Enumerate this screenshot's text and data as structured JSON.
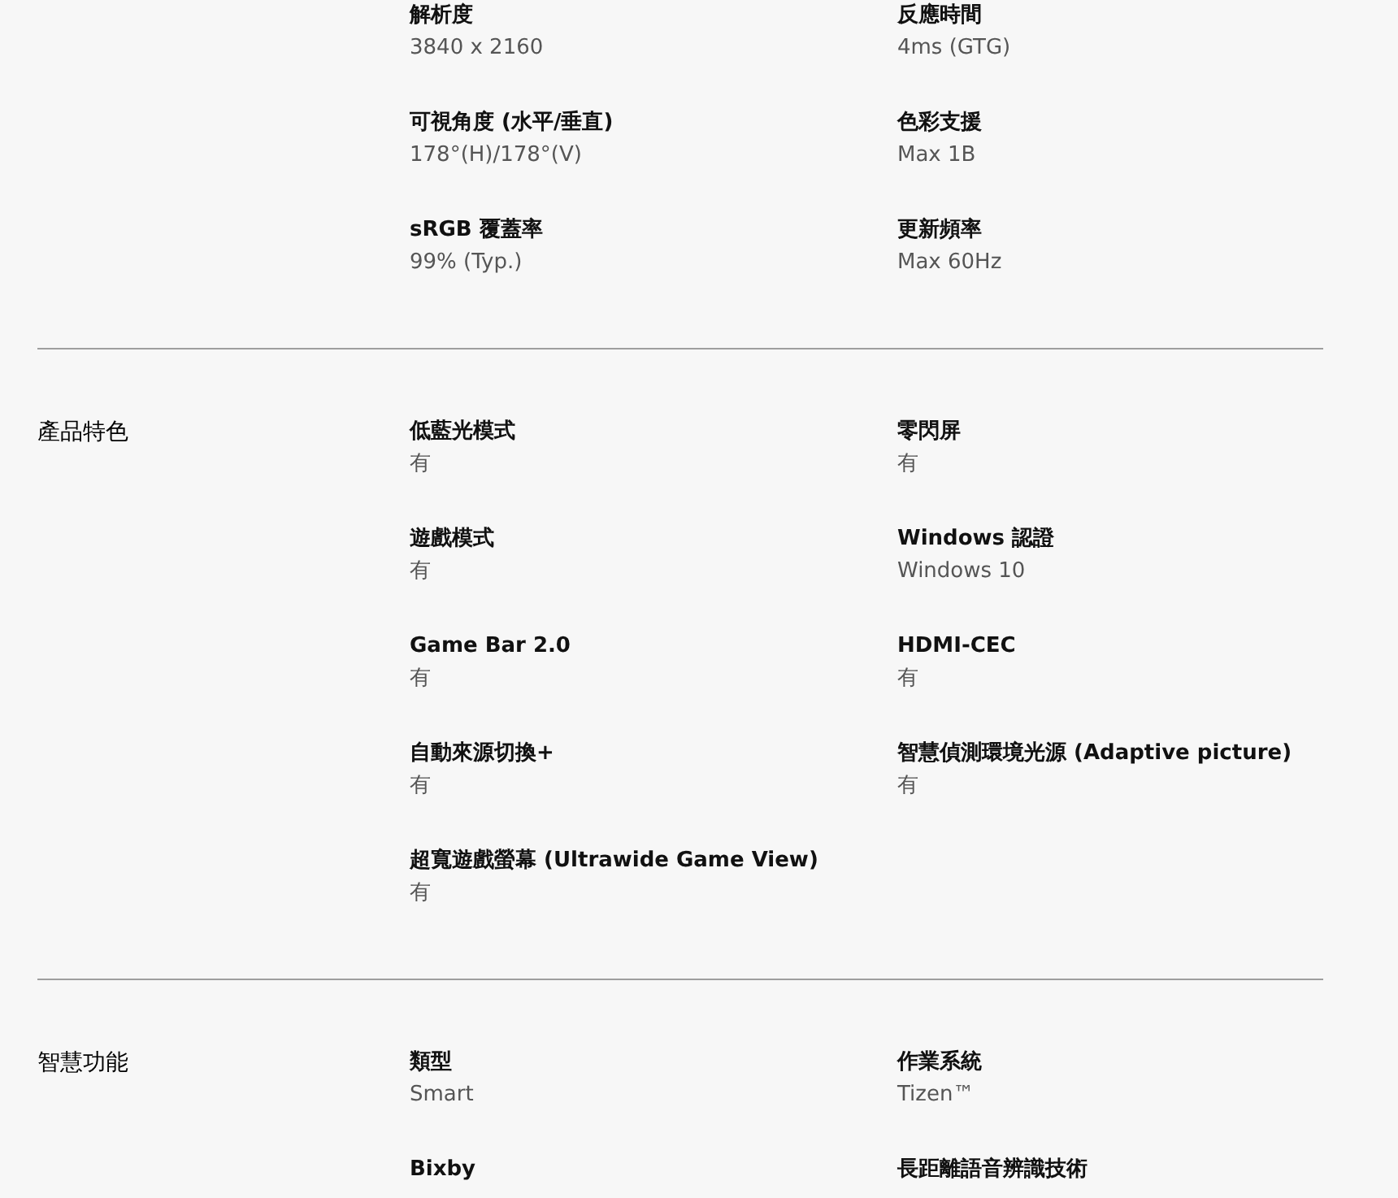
{
  "sections": [
    {
      "items": [
        {
          "label": "解析度",
          "value": "3840 x 2160"
        },
        {
          "label": "反應時間",
          "value": "4ms (GTG)"
        },
        {
          "label": "可視角度 (水平/垂直)",
          "value": "178°(H)/178°(V)"
        },
        {
          "label": "色彩支援",
          "value": "Max 1B"
        },
        {
          "label": "sRGB 覆蓋率",
          "value": "99% (Typ.)"
        },
        {
          "label": "更新頻率",
          "value": "Max 60Hz"
        }
      ]
    },
    {
      "title": "產品特色",
      "items": [
        {
          "label": "低藍光模式",
          "value": "有"
        },
        {
          "label": "零閃屏",
          "value": "有"
        },
        {
          "label": "遊戲模式",
          "value": "有"
        },
        {
          "label": "Windows 認證",
          "value": "Windows 10"
        },
        {
          "label": "Game Bar 2.0",
          "value": "有"
        },
        {
          "label": "HDMI-CEC",
          "value": "有"
        },
        {
          "label": "自動來源切換+",
          "value": "有"
        },
        {
          "label": "智慧偵測環境光源 (Adaptive picture)",
          "value": "有"
        },
        {
          "label": "超寬遊戲螢幕 (Ultrawide Game View)",
          "value": "有"
        }
      ]
    },
    {
      "title": "智慧功能",
      "items": [
        {
          "label": "類型",
          "value": "Smart"
        },
        {
          "label": "作業系統",
          "value": "Tizen™"
        },
        {
          "label": "Bixby"
        },
        {
          "label": "長距離語音辨識技術"
        }
      ]
    }
  ]
}
